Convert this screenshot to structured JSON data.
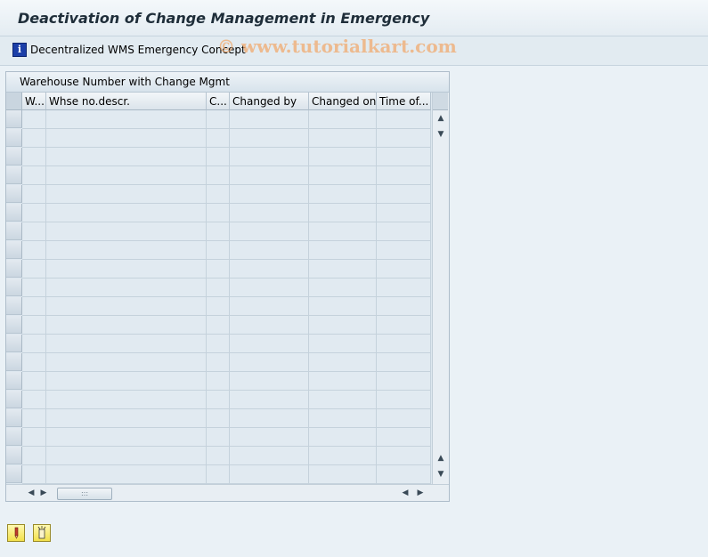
{
  "page": {
    "title": "Deactivation of Change Management in Emergency",
    "watermark": "© www.tutorialkart.com"
  },
  "toolbar": {
    "info_button_label": "Decentralized WMS Emergency Concept",
    "info_icon": "info-icon"
  },
  "panel": {
    "title": "Warehouse Number with Change Mgmt"
  },
  "table": {
    "columns": [
      "W...",
      "Whse no.descr.",
      "C...",
      "Changed by",
      "Changed on",
      "Time of..."
    ],
    "visible_row_count": 20,
    "rows": []
  },
  "scrollbars": {
    "up_arrow": "▲",
    "down_arrow": "▼",
    "left_arrow": "◀",
    "right_arrow": "▶",
    "thumb_grip": ":::"
  },
  "footer_buttons": [
    {
      "name": "activate-button",
      "icon": "pencil-icon"
    },
    {
      "name": "deactivate-button",
      "icon": "lightning-icon"
    }
  ],
  "colors": {
    "background": "#eaf1f6",
    "grid_cell": "#e1eaf1",
    "button_yellow": "#f2e04a",
    "watermark": "#f0aa6e"
  }
}
